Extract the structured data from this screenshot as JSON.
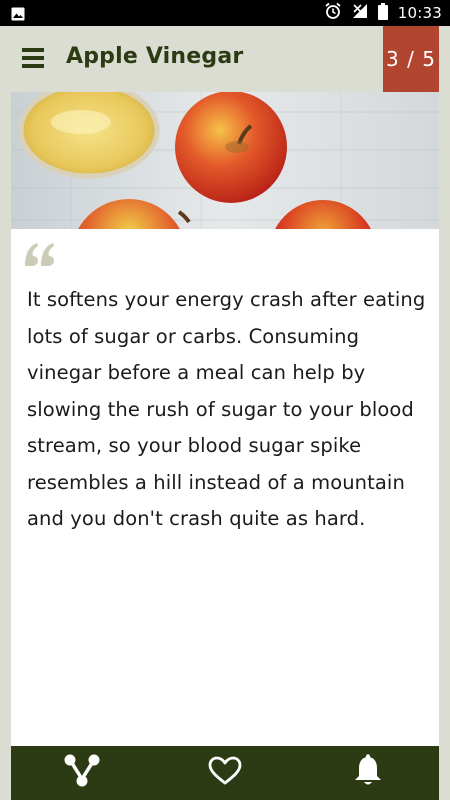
{
  "status_bar": {
    "time": "10:33",
    "icons": [
      "image-icon",
      "alarm-icon",
      "signal-icon",
      "battery-icon"
    ]
  },
  "app_bar": {
    "title": "Apple Vinegar",
    "counter": "3 / 5"
  },
  "card": {
    "image": "apples-and-vinegar-photo",
    "quote_icon": "quote-icon",
    "text": "It softens your energy crash after eating lots of sugar or carbs. Consuming vinegar before a meal can help by slowing the rush of sugar to your blood stream, so your blood sugar spike resembles a hill instead of a mountain and you don't crash quite as hard."
  },
  "bottom_bar": {
    "items": [
      "share-icon",
      "heart-icon",
      "bell-icon"
    ]
  },
  "colors": {
    "background": "#dcddd2",
    "primary": "#2d3b15",
    "accent": "#b24530",
    "quote": "#cbcbb8"
  }
}
